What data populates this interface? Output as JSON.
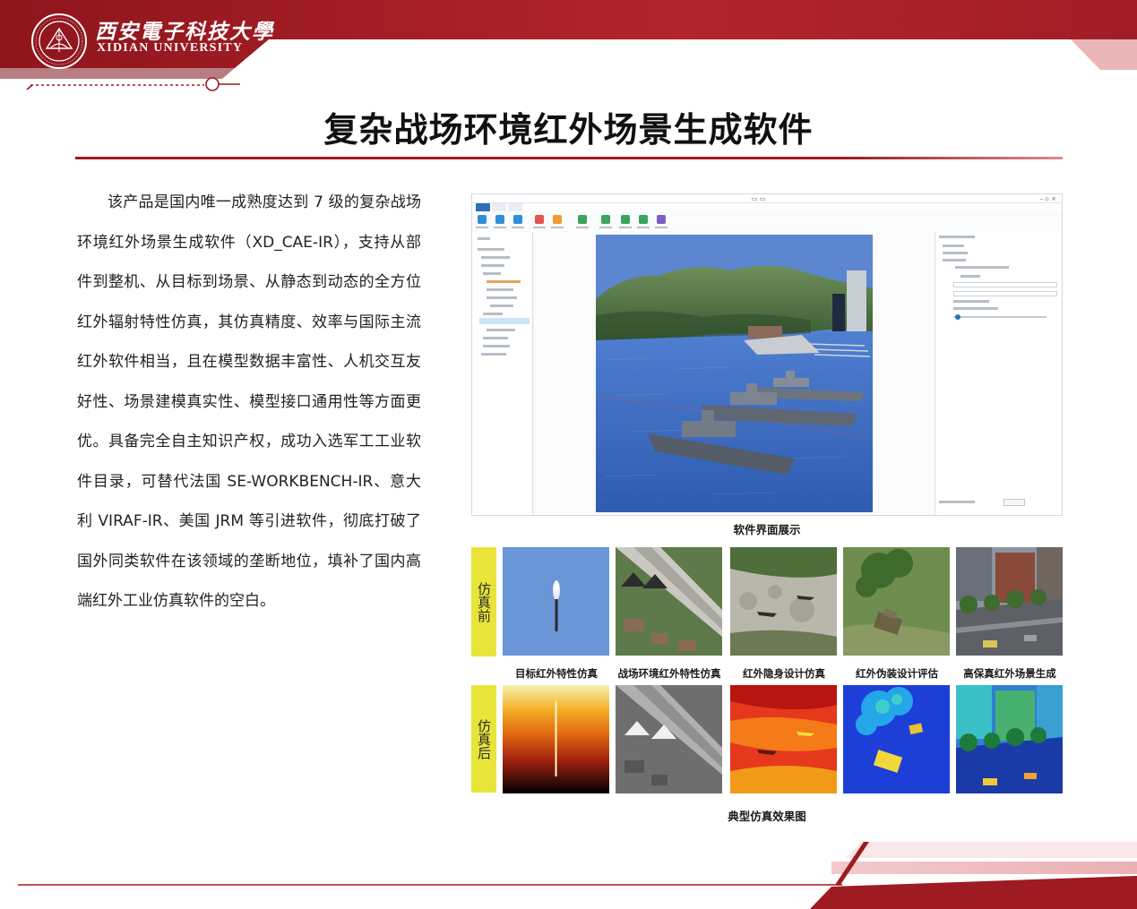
{
  "header": {
    "university_cn": "西安電子科技大學",
    "university_en": "XIDIAN UNIVERSITY"
  },
  "title": "复杂战场环境红外场景生成软件",
  "description": "该产品是国内唯一成熟度达到 7 级的复杂战场环境红外场景生成软件（XD_CAE-IR），支持从部件到整机、从目标到场景、从静态到动态的全方位红外辐射特性仿真，其仿真精度、效率与国际主流红外软件相当，且在模型数据丰富性、人机交互友好性、场景建模真实性、模型接口通用性等方面更优。具备完全自主知识产权，成功入选军工工业软件目录，可替代法国 SE-WORKBENCH-IR、意大利 VIRAF-IR、美国 JRM 等引进软件，彻底打破了国外同类软件在该领域的垄断地位，填补了国内高端红外工业仿真软件的空白。",
  "screenshot_caption": "软件界面展示",
  "effects": {
    "before_label": "仿真前",
    "after_label": "仿真后",
    "captions": [
      "目标红外特性仿真",
      "战场环境红外特性仿真",
      "红外隐身设计仿真",
      "红外伪装设计评估",
      "高保真红外场景生成"
    ],
    "caption": "典型仿真效果图"
  },
  "colors": {
    "brand_red": "#9e1b22",
    "label_yellow": "#e8e43a"
  }
}
